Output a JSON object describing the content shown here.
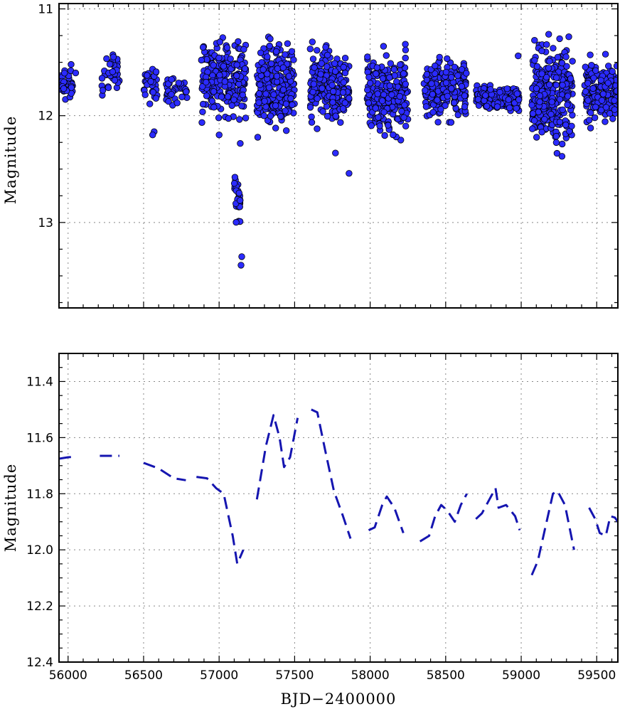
{
  "chart_data": [
    {
      "type": "scatter",
      "ylabel": "Magnitude",
      "xlim": [
        55940,
        59640
      ],
      "ylim": [
        13.8,
        10.95
      ],
      "y_inverted": true,
      "xticks": [
        56000,
        56500,
        57000,
        57500,
        58000,
        58500,
        59000,
        59500
      ],
      "yticks": [
        11,
        12,
        13
      ],
      "yticks_labels": [
        "11",
        "12",
        "13"
      ],
      "grid": true,
      "marker_color": "#2b2bff",
      "marker_edge": "#000000",
      "clusters": [
        {
          "x": [
            55950,
            56030
          ],
          "ymin": 11.55,
          "ymax": 11.88,
          "n": 40,
          "extra": [
            [
              56020,
              11.52
            ],
            [
              56050,
              11.6
            ]
          ]
        },
        {
          "x": [
            56220,
            56340
          ],
          "ymin": 11.42,
          "ymax": 11.85,
          "n": 35,
          "extra": [
            [
              56300,
              11.45
            ]
          ]
        },
        {
          "x": [
            56500,
            56590
          ],
          "ymin": 11.5,
          "ymax": 11.9,
          "n": 35,
          "extra": [
            [
              56570,
              12.15
            ],
            [
              56560,
              12.18
            ]
          ]
        },
        {
          "x": [
            56650,
            56790
          ],
          "ymin": 11.6,
          "ymax": 11.9,
          "n": 40,
          "extra": []
        },
        {
          "x": [
            56880,
            57180
          ],
          "ymin": 11.25,
          "ymax": 12.05,
          "n": 230,
          "extra": [
            [
              57000,
              12.18
            ],
            [
              57140,
              12.26
            ]
          ]
        },
        {
          "x": [
            57100,
            57140
          ],
          "ymin": 12.5,
          "ymax": 13.1,
          "n": 30,
          "extra": [
            [
              57150,
              13.32
            ],
            [
              57145,
              13.4
            ]
          ]
        },
        {
          "x": [
            57250,
            57500
          ],
          "ymin": 11.25,
          "ymax": 12.15,
          "n": 230,
          "extra": []
        },
        {
          "x": [
            57600,
            57860
          ],
          "ymin": 11.3,
          "ymax": 12.1,
          "n": 200,
          "extra": [
            [
              57770,
              12.35
            ],
            [
              57860,
              12.54
            ]
          ]
        },
        {
          "x": [
            57980,
            58250
          ],
          "ymin": 11.35,
          "ymax": 12.25,
          "n": 220,
          "extra": []
        },
        {
          "x": [
            58350,
            58640
          ],
          "ymin": 11.45,
          "ymax": 12.05,
          "n": 200,
          "extra": []
        },
        {
          "x": [
            58700,
            58990
          ],
          "ymin": 11.72,
          "ymax": 11.96,
          "n": 190,
          "extra": [
            [
              58980,
              11.44
            ]
          ]
        },
        {
          "x": [
            59070,
            59340
          ],
          "ymin": 11.25,
          "ymax": 12.35,
          "n": 270,
          "extra": [
            [
              59270,
              12.38
            ]
          ]
        },
        {
          "x": [
            59420,
            59640
          ],
          "ymin": 11.45,
          "ymax": 12.1,
          "n": 170,
          "extra": []
        }
      ]
    },
    {
      "type": "line",
      "ylabel": "Magnitude",
      "xlabel": "BJD−2400000",
      "xlim": [
        55940,
        59640
      ],
      "ylim": [
        12.4,
        11.3
      ],
      "y_inverted": true,
      "xticks": [
        56000,
        56500,
        57000,
        57500,
        58000,
        58500,
        59000,
        59500
      ],
      "xticks_labels": [
        "56000",
        "56500",
        "57000",
        "57500",
        "58000",
        "58500",
        "59000",
        "59500"
      ],
      "yticks": [
        11.4,
        11.6,
        11.8,
        12.0,
        12.2,
        12.4
      ],
      "yticks_labels": [
        "11.4",
        "11.6",
        "11.8",
        "12.0",
        "12.2",
        "12.4"
      ],
      "grid": true,
      "line_color": "#1515b0",
      "line_style": "dashed",
      "segments": [
        [
          [
            55940,
            11.675
          ],
          [
            56000,
            11.67
          ],
          [
            56050,
            11.668
          ]
        ],
        [
          [
            56210,
            11.665
          ],
          [
            56340,
            11.665
          ]
        ],
        [
          [
            56500,
            11.69
          ],
          [
            56600,
            11.71
          ],
          [
            56700,
            11.745
          ],
          [
            56780,
            11.752
          ]
        ],
        [
          [
            56850,
            11.74
          ],
          [
            56920,
            11.745
          ],
          [
            56980,
            11.78
          ],
          [
            57030,
            11.8
          ],
          [
            57090,
            11.95
          ],
          [
            57120,
            12.05
          ],
          [
            57160,
            12.0
          ]
        ],
        [
          [
            57250,
            11.82
          ],
          [
            57310,
            11.63
          ],
          [
            57360,
            11.52
          ],
          [
            57400,
            11.6
          ],
          [
            57430,
            11.705
          ],
          [
            57470,
            11.67
          ],
          [
            57520,
            11.53
          ]
        ],
        [
          [
            57610,
            11.5
          ],
          [
            57650,
            11.51
          ],
          [
            57700,
            11.64
          ],
          [
            57760,
            11.79
          ],
          [
            57820,
            11.88
          ],
          [
            57870,
            11.96
          ]
        ],
        [
          [
            57990,
            11.93
          ],
          [
            58030,
            11.92
          ],
          [
            58080,
            11.84
          ],
          [
            58110,
            11.81
          ],
          [
            58160,
            11.85
          ],
          [
            58220,
            11.94
          ]
        ],
        [
          [
            58330,
            11.97
          ],
          [
            58390,
            11.95
          ],
          [
            58430,
            11.88
          ],
          [
            58470,
            11.84
          ],
          [
            58510,
            11.86
          ],
          [
            58560,
            11.9
          ],
          [
            58600,
            11.84
          ],
          [
            58640,
            11.8
          ]
        ],
        [
          [
            58700,
            11.89
          ],
          [
            58740,
            11.87
          ],
          [
            58790,
            11.82
          ],
          [
            58830,
            11.78
          ],
          [
            58850,
            11.85
          ],
          [
            58900,
            11.84
          ],
          [
            58960,
            11.88
          ],
          [
            58990,
            11.93
          ]
        ],
        [
          [
            59070,
            12.09
          ],
          [
            59110,
            12.04
          ],
          [
            59160,
            11.92
          ],
          [
            59210,
            11.8
          ],
          [
            59240,
            11.79
          ],
          [
            59290,
            11.84
          ],
          [
            59350,
            12.0
          ]
        ],
        [
          [
            59450,
            11.85
          ],
          [
            59490,
            11.89
          ],
          [
            59520,
            11.94
          ],
          [
            59560,
            11.95
          ],
          [
            59590,
            11.88
          ],
          [
            59620,
            11.885
          ],
          [
            59640,
            11.9
          ]
        ]
      ]
    }
  ]
}
